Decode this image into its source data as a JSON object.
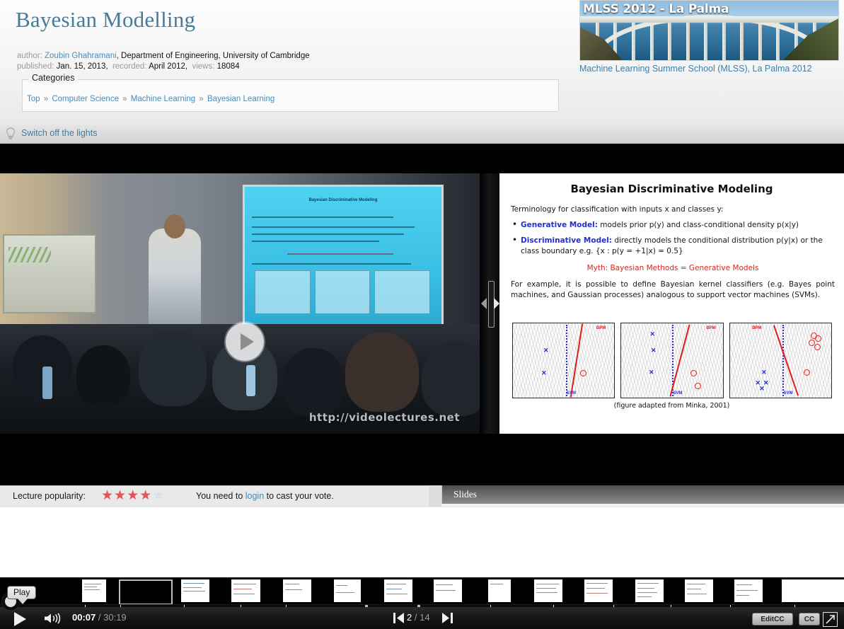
{
  "page": {
    "title": "Bayesian Modelling"
  },
  "meta": {
    "author_label": "author:",
    "author_name": "Zoubin Ghahramani",
    "author_affiliation": ", Department of Engineering, University of Cambridge",
    "published_label": "published:",
    "published_value": "Jan. 15, 2013,",
    "recorded_label": "recorded:",
    "recorded_value": "April 2012,",
    "views_label": "views:",
    "views_value": "18084"
  },
  "categories": {
    "legend": "Categories",
    "items": [
      "Top",
      "Computer Science",
      "Machine Learning",
      "Bayesian Learning"
    ],
    "separator": "»"
  },
  "event": {
    "banner_text": "MLSS 2012 - La Palma",
    "title": "Machine Learning Summer School (MLSS), La Palma 2012"
  },
  "lights": {
    "label": "Switch off the lights",
    "icon": "lightbulb-icon"
  },
  "video": {
    "screen_title": "Bayesian Discriminative Modeling",
    "watermark": "http://videolectures.net",
    "play_overlay_icon": "play-icon"
  },
  "slide": {
    "title": "Bayesian Discriminative Modeling",
    "intro": "Terminology for classification with inputs x and classes y:",
    "bullets": [
      {
        "term": "Generative Model:",
        "text": " models prior p(y) and class-conditional density p(x|y)"
      },
      {
        "term": "Discriminative Model:",
        "text": " directly models the conditional distribution p(y|x) or the class boundary e.g. {x : p(y = +1|x) = 0.5}"
      }
    ],
    "myth": "Myth: Bayesian Methods = Generative Models",
    "paragraph": "For example, it is possible to define Bayesian kernel classifiers (e.g. Bayes point machines, and Gaussian processes) analogous to support vector machines (SVMs).",
    "figure_caption": "(figure adapted from Minka, 2001)",
    "figure_labels": {
      "bpm": "BPM",
      "svm": "SVM"
    }
  },
  "controls": {
    "play_tooltip": "Play",
    "play_icon": "play-icon",
    "volume_icon": "volume-icon",
    "current_time": "00:07",
    "time_separator": "/",
    "total_time": "30:19",
    "prev_slide_icon": "previous-slide-icon",
    "next_slide_icon": "next-slide-icon",
    "slide_current": "2",
    "slide_separator": "/",
    "slide_total": "14",
    "editcc_label": "EditCC",
    "cc_label": "CC",
    "fullscreen_icon": "fullscreen-icon"
  },
  "footer": {
    "popularity_label": "Lecture popularity:",
    "stars_full": 4,
    "stars_half": 1,
    "vote_prefix": "You need to ",
    "vote_link": "login",
    "vote_suffix": " to cast your vote.",
    "slides_tab": "Slides"
  },
  "colors": {
    "accent_link": "#4a8cb8",
    "title": "#4a7a96",
    "star": "#e2545b",
    "slide_bullet_term": "#1f2fd0",
    "slide_myth": "#e02020"
  }
}
